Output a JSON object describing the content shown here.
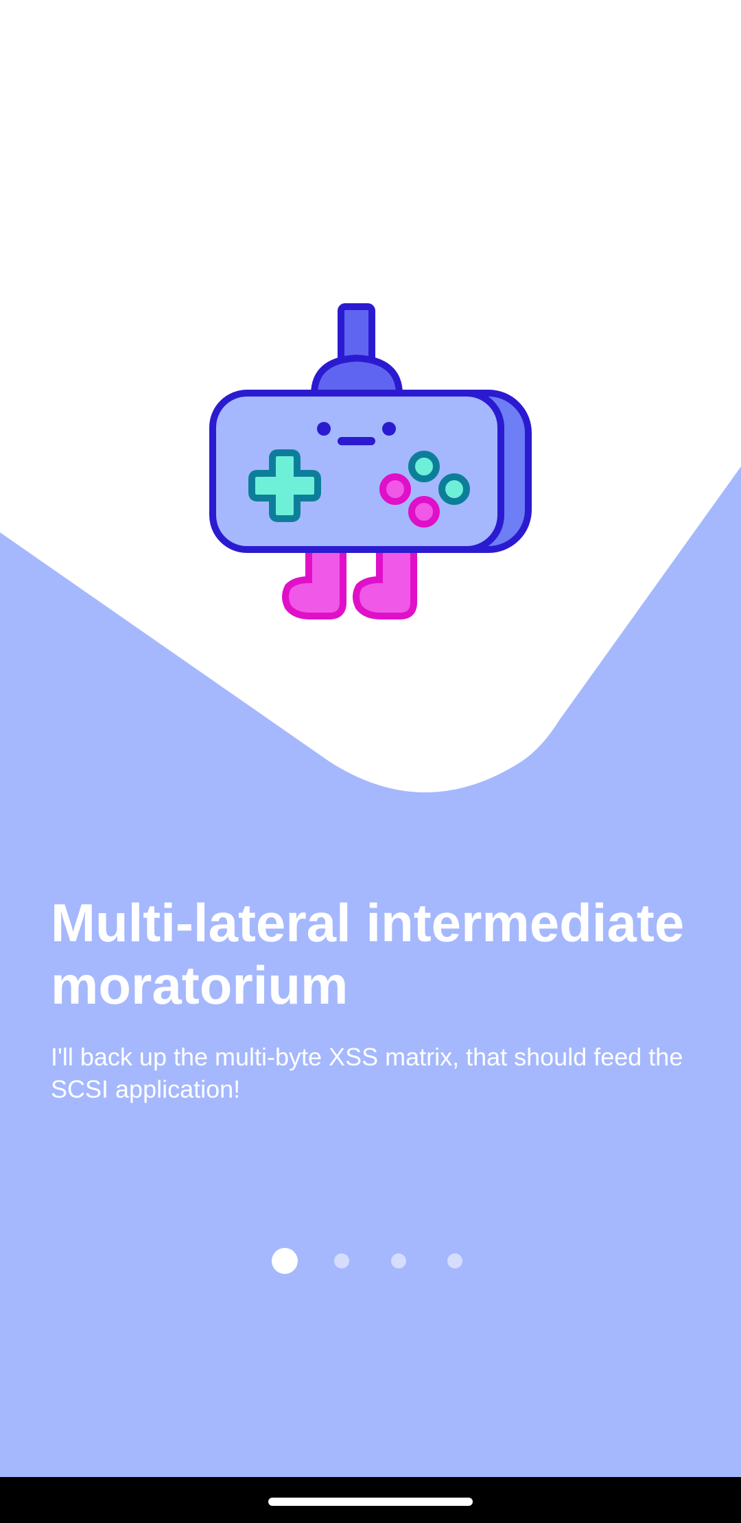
{
  "onboarding": {
    "title": "Multi-lateral intermediate moratorium",
    "subtitle": "I'll back up the multi-byte XSS matrix, that should feed the SCSI application!",
    "page_indicator": {
      "total": 4,
      "current": 1
    }
  },
  "illustration": {
    "icon": "gamepad-robot-icon"
  },
  "colors": {
    "background_bottom": "#a5b8fd",
    "background_top": "#ffffff",
    "text": "#ffffff",
    "mascot_outline": "#2b1bd0",
    "mascot_body": "#a5b8fd",
    "mascot_accent": "#5f65f0",
    "dpad": "#6ef0d8",
    "pink": "#f058e8"
  }
}
